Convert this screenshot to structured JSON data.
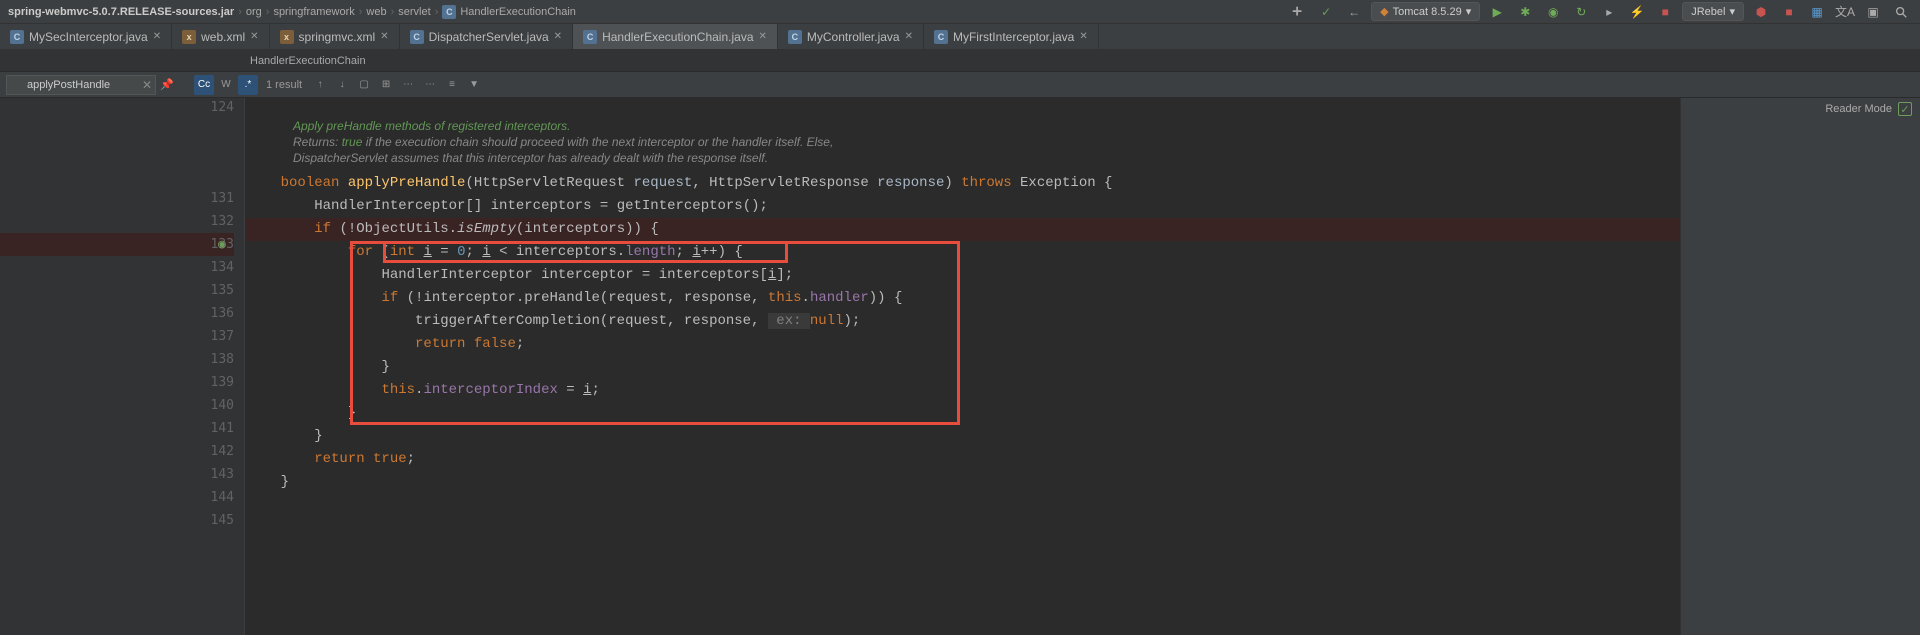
{
  "breadcrumb": {
    "items": [
      "spring-webmvc-5.0.7.RELEASE-sources.jar",
      "org",
      "springframework",
      "web",
      "servlet",
      "HandlerExecutionChain"
    ]
  },
  "runConfig": {
    "label": "Tomcat 8.5.29",
    "rebelLabel": "JRebel"
  },
  "tabs": [
    {
      "label": "MySecInterceptor.java",
      "active": false,
      "icon": "java"
    },
    {
      "label": "web.xml",
      "active": false,
      "icon": "xml"
    },
    {
      "label": "springmvc.xml",
      "active": false,
      "icon": "xml"
    },
    {
      "label": "DispatcherServlet.java",
      "active": false,
      "icon": "java"
    },
    {
      "label": "HandlerExecutionChain.java",
      "active": true,
      "icon": "java"
    },
    {
      "label": "MyController.java",
      "active": false,
      "icon": "java"
    },
    {
      "label": "MyFirstInterceptor.java",
      "active": false,
      "icon": "java"
    }
  ],
  "contextBar": {
    "text": "HandlerExecutionChain"
  },
  "find": {
    "query": "applyPostHandle",
    "results": "1 result",
    "opts": {
      "cc": "Cc",
      "w": "W",
      "regex": ".*"
    }
  },
  "lineNumbers": [
    "124",
    "",
    "",
    "",
    "131",
    "132",
    "133",
    "134",
    "135",
    "136",
    "137",
    "138",
    "139",
    "140",
    "141",
    "142",
    "143",
    "144",
    "145"
  ],
  "doc": {
    "l1": "Apply preHandle methods of registered interceptors.",
    "l2a": "Returns: ",
    "l2b": "true",
    "l2c": " if the execution chain should proceed with the next interceptor or the handler itself. Else,",
    "l3": "DispatcherServlet assumes that this interceptor has already dealt with the response itself."
  },
  "code": {
    "l131": {
      "kw1": "boolean",
      "name": "applyPreHandle",
      "p1a": "HttpServletRequest ",
      "p1b": "request",
      "c1": ", ",
      "p2a": "HttpServletResponse ",
      "p2b": "response",
      "paren": ") ",
      "kw2": "throws",
      "exc": " Exception {"
    },
    "l132": {
      "pre": "    ",
      "type": "HandlerInterceptor[] ",
      "var": "interceptors = ",
      "call": "getInterceptors();"
    },
    "l133": {
      "pre": "    ",
      "kw": "if ",
      "open": "(!",
      "cls": "ObjectUtils",
      "dot": ".",
      "it": "isEmpty",
      "args": "(interceptors)) {"
    },
    "l134": {
      "pre": "        ",
      "kw": "for ",
      "open": "(",
      "kw2": "int ",
      "v": "i",
      "eq": " = ",
      "n": "0",
      "sc": "; ",
      "v2": "i",
      "cmp": " < interceptors.",
      "len": "length",
      "sc2": "; ",
      "v3": "i",
      "inc": "++) {"
    },
    "l135": {
      "pre": "            ",
      "type": "HandlerInterceptor ",
      "var": "interceptor = interceptors[",
      "v": "i",
      "end": "];"
    },
    "l136": {
      "pre": "            ",
      "kw": "if ",
      "open": "(!interceptor.preHandle(request, response, ",
      "kw2": "this",
      "dot": ".",
      "fld": "handler",
      ")) {": ")) {"
    },
    "l137": {
      "pre": "                ",
      "call": "triggerAfterCompletion(request, response, ",
      "hint": " ex: ",
      "kw": "null",
      "end": ");"
    },
    "l138": {
      "pre": "                ",
      "kw": "return false",
      "end": ";"
    },
    "l139": {
      "pre": "            ",
      "b": "}"
    },
    "l140": {
      "pre": "            ",
      "kw": "this",
      "dot": ".",
      "fld": "interceptorIndex",
      " = ": " = ",
      "v": "i",
      "end": ";"
    },
    "l141": {
      "pre": "        ",
      "b": "}"
    },
    "l142": {
      "pre": "    ",
      "b": "}"
    },
    "l143": {
      "pre": "    ",
      "kw": "return true",
      "end": ";"
    },
    "l144": {
      "b": "}"
    }
  },
  "readerMode": {
    "label": "Reader Mode"
  }
}
